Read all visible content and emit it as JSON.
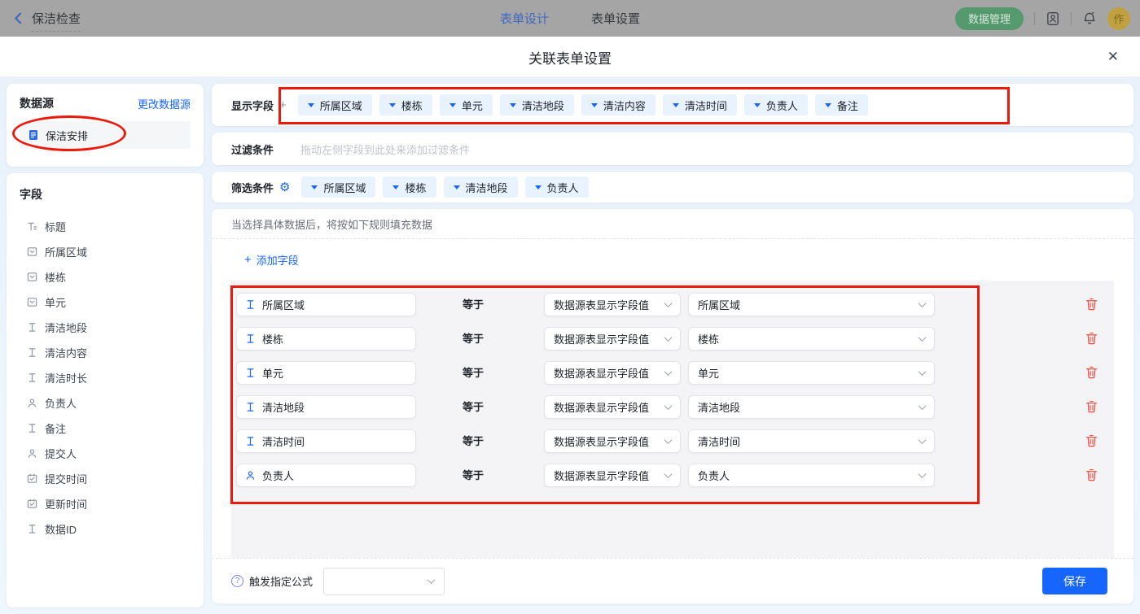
{
  "topbar": {
    "back_label": "保洁检查",
    "tabs": [
      {
        "label": "表单设计",
        "active": true
      },
      {
        "label": "表单设置",
        "active": false
      }
    ],
    "data_manage_label": "数据管理",
    "avatar_text": "作"
  },
  "modal": {
    "title": "关联表单设置",
    "close_glyph": "✕"
  },
  "sidebar": {
    "datasource_title": "数据源",
    "change_datasource_link": "更改数据源",
    "datasource_item": "保洁安排",
    "fields_title": "字段",
    "fields": [
      {
        "icon": "title-icon",
        "label": "标题"
      },
      {
        "icon": "select-field-icon",
        "label": "所属区域"
      },
      {
        "icon": "select-field-icon",
        "label": "楼栋"
      },
      {
        "icon": "select-field-icon",
        "label": "单元"
      },
      {
        "icon": "text-field-icon",
        "label": "清洁地段"
      },
      {
        "icon": "text-field-icon",
        "label": "清洁内容"
      },
      {
        "icon": "text-field-icon",
        "label": "清洁时长"
      },
      {
        "icon": "user-icon",
        "label": "负责人"
      },
      {
        "icon": "text-field-icon",
        "label": "备注"
      },
      {
        "icon": "user-icon",
        "label": "提交人"
      },
      {
        "icon": "calendar-icon",
        "label": "提交时间"
      },
      {
        "icon": "calendar-icon",
        "label": "更新时间"
      },
      {
        "icon": "text-field-icon",
        "label": "数据ID"
      }
    ]
  },
  "display_fields": {
    "label": "显示字段",
    "add_glyph": "+",
    "tags": [
      "所属区域",
      "楼栋",
      "单元",
      "清洁地段",
      "清洁内容",
      "清洁时间",
      "负责人",
      "备注"
    ]
  },
  "filter": {
    "label": "过滤条件",
    "placeholder": "拖动左侧字段到此处来添加过滤条件"
  },
  "screening": {
    "label": "筛选条件",
    "tags": [
      "所属区域",
      "楼栋",
      "清洁地段",
      "负责人"
    ]
  },
  "rules": {
    "hint": "当选择具体数据后，将按如下规则填充数据",
    "add_plus": "+",
    "add_field_label": "添加字段",
    "equals_label": "等于",
    "source_option": "数据源表显示字段值",
    "rows": [
      {
        "icon": "text-field-icon",
        "field": "所属区域",
        "value": "所属区域"
      },
      {
        "icon": "text-field-icon",
        "field": "楼栋",
        "value": "楼栋"
      },
      {
        "icon": "text-field-icon",
        "field": "单元",
        "value": "单元"
      },
      {
        "icon": "text-field-icon",
        "field": "清洁地段",
        "value": "清洁地段"
      },
      {
        "icon": "text-field-icon",
        "field": "清洁时间",
        "value": "清洁时间"
      },
      {
        "icon": "user-icon",
        "field": "负责人",
        "value": "负责人"
      }
    ]
  },
  "footer": {
    "help_glyph": "?",
    "formula_label": "触发指定公式",
    "save_label": "保存"
  },
  "colors": {
    "accent": "#1665ff",
    "tag-bg": "#e8f3ff",
    "annotation": "#ea1b0d",
    "danger": "#f0483e",
    "panel-grey": "#f4f4f6",
    "body-bg": "#e9f1fb",
    "green": "#549a6e",
    "avatar-gold": "#c1a040"
  }
}
